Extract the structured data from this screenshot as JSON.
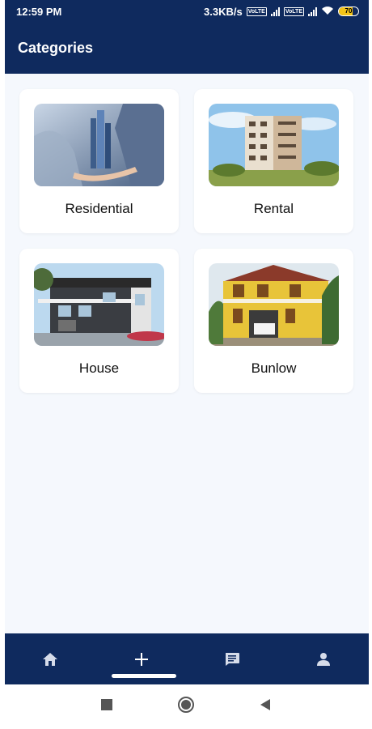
{
  "status_bar": {
    "time": "12:59 PM",
    "speed": "3.3KB/s",
    "volte_1": "Vo LTE",
    "volte_2": "Vo LTE",
    "battery": "70",
    "battery_level": 0.7
  },
  "app_bar": {
    "title": "Categories"
  },
  "categories": [
    {
      "label": "Residential",
      "image": "business-person-holding-buildings"
    },
    {
      "label": "Rental",
      "image": "apartment-building"
    },
    {
      "label": "House",
      "image": "modern-house"
    },
    {
      "label": "Bunlow",
      "image": "yellow-bungalow"
    }
  ],
  "bottom_nav": {
    "items": [
      {
        "icon": "home-icon"
      },
      {
        "icon": "plus-icon"
      },
      {
        "icon": "message-icon"
      },
      {
        "icon": "person-icon"
      }
    ]
  },
  "system_nav": {
    "items": [
      {
        "icon": "square-icon"
      },
      {
        "icon": "circle-icon"
      },
      {
        "icon": "back-triangle-icon"
      }
    ]
  },
  "colors": {
    "primary": "#0f2a5e",
    "background": "#f5f8fd",
    "card": "#ffffff"
  }
}
